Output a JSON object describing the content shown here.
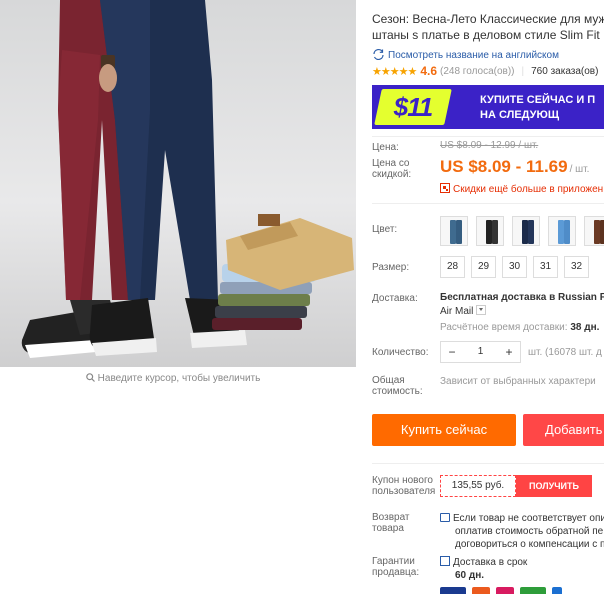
{
  "gallery": {
    "zoom_hint": "Наведите курсор, чтобы увеличить"
  },
  "product": {
    "title_line1": "Сезон: Весна-Лето Классические для муж",
    "title_line2": "штаны s платье в деловом стиле Slim Fit",
    "translate_link": "Посмотреть название на английском",
    "rating_stars": "★★★★★",
    "rating": "4.6",
    "votes": "(248 голоса(ов))",
    "orders": "760 заказа(ов)"
  },
  "banner": {
    "price": "$11",
    "line1": "КУПИТЕ СЕЙЧАС И П",
    "line2": "НА СЛЕДУЮЩ"
  },
  "price": {
    "label": "Цена:",
    "old": "US $8.09 - 12.99 / шт.",
    "discount_label": "Цена со скидкой:",
    "sale": "US $8.09 - 11.69",
    "unit": "/ шт.",
    "app_discount": "Скидки ещё больше в приложен"
  },
  "options": {
    "color_label": "Цвет:",
    "colors": [
      "steel-blue",
      "black",
      "navy",
      "light-blue",
      "brown"
    ],
    "size_label": "Размер:",
    "sizes": [
      "28",
      "29",
      "30",
      "31",
      "32"
    ]
  },
  "shipping": {
    "label": "Доставка:",
    "title": "Бесплатная доставка в Russian Fe",
    "method": "Air Mail",
    "eta_label": "Расчётное время доставки:",
    "eta_value": "38 дн."
  },
  "quantity": {
    "label": "Количество:",
    "minus": "−",
    "value": "1",
    "plus": "+",
    "stock": "шт. (16078 шт. д"
  },
  "total": {
    "label": "Общая стоимость:",
    "value": "Зависит от выбранных характери"
  },
  "actions": {
    "buy_now": "Купить сейчас",
    "add_to_cart": "Добавить"
  },
  "coupon": {
    "label": "Купон нового пользователя",
    "amount": "135,55 руб.",
    "button": "ПОЛУЧИТЬ"
  },
  "returns": {
    "label": "Возврат товара",
    "line1": "Если товар не соответствует опи",
    "line2": "оплатив стоимость обратной пе",
    "line3": "договориться о компенсации с п"
  },
  "guarantee": {
    "label": "Гарантии продавца:",
    "line1": "Доставка в срок",
    "line2": "60 дн."
  },
  "colors": {
    "accent_orange": "#ff6a00",
    "price_orange": "#f26b0f",
    "cart_red": "#ff4747",
    "banner_purple": "#3b22c7",
    "banner_yellow": "#e4ff2f"
  }
}
